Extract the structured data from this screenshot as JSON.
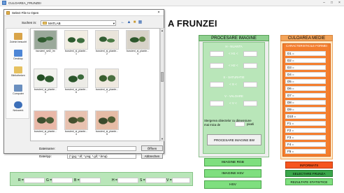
{
  "window": {
    "title": "CULOAREA_FRUNZEI",
    "minimize": "–",
    "maximize": "□",
    "close": "×"
  },
  "app_title": "A FRUNZEI",
  "processing_panel": {
    "header": "PROCESARE IMAGINE",
    "hue_title": "H - NUANTA",
    "h1_label": "< H1 <",
    "h2_label": "< H2 <",
    "sat_title": "S - SATURATIE",
    "s_label": "< S <",
    "val_title": "V - VALOARE",
    "v_label": "< V <",
    "delete_text": "Stergerea obiectelor cu dimensiune mai mica de",
    "pixels_label": "pixeli",
    "process_button": "PROCESARE IMAGINE BW",
    "buttons": [
      "IMAGINE RGB",
      "IMAGINE HSV",
      "HSV"
    ]
  },
  "medium_color_panel": {
    "header": "CULOAREA MEDIE",
    "subtitle": "CARACTERISTICILE FORMEI",
    "rows": [
      "D1 =",
      "D2 =",
      "D3 =",
      "D4 =",
      "D5 =",
      "D6 =",
      "D7 =",
      "D8 =",
      "D9 =",
      "D10 =",
      "F1 =",
      "F2 =",
      "F3 =",
      "F4 =",
      "F5 ="
    ],
    "info_button": "INFORMATII",
    "select_button": "SELECTARE FRUNZA",
    "stats_button": "REZULTATE STATISTICE",
    "colors": {
      "info": "#f5541e",
      "select": "#3aa64a",
      "stats": "#7fe07f"
    }
  },
  "bottom_bar": {
    "labels": [
      "R =",
      "G =",
      "B =",
      "H =",
      "S =",
      "V ="
    ]
  },
  "dialog": {
    "title": "Select File to Open",
    "close": "×",
    "look_in_label": "Suchen in:",
    "look_in_value": "MATLAB",
    "places": [
      "Zuletzt besucht",
      "Desktop",
      "Bibliotheken",
      "Computer",
      "Netzwerk"
    ],
    "files": [
      {
        "name": "buruieni_set2_im",
        "sub": "7"
      },
      {
        "name": "buruieni_si_plante...",
        "sub": "1"
      },
      {
        "name": "buruieni_si_plante...",
        "sub": "2"
      },
      {
        "name": "buruieni_si_plante...",
        "sub": "4"
      },
      {
        "name": "buruieni_si_plante...",
        "sub": "5"
      },
      {
        "name": "buruieni_si_plante...",
        "sub": "6"
      },
      {
        "name": "buruieni_si_plante...",
        "sub": "7"
      },
      {
        "name": "buruieni_si_plante...",
        "sub": "2"
      },
      {
        "name": "buruieni_si_plante...",
        "sub": "4"
      },
      {
        "name": "buruieni_si_plante...",
        "sub": "5"
      }
    ],
    "filename_label": "Dateiname:",
    "filename_value": "",
    "filetype_label": "Dateityp:",
    "filetype_value": "(*.jpg; *.tif; *.png; *.gif; *.bmp)",
    "open_button": "Öffnen",
    "cancel_button": "Abbrechen"
  }
}
